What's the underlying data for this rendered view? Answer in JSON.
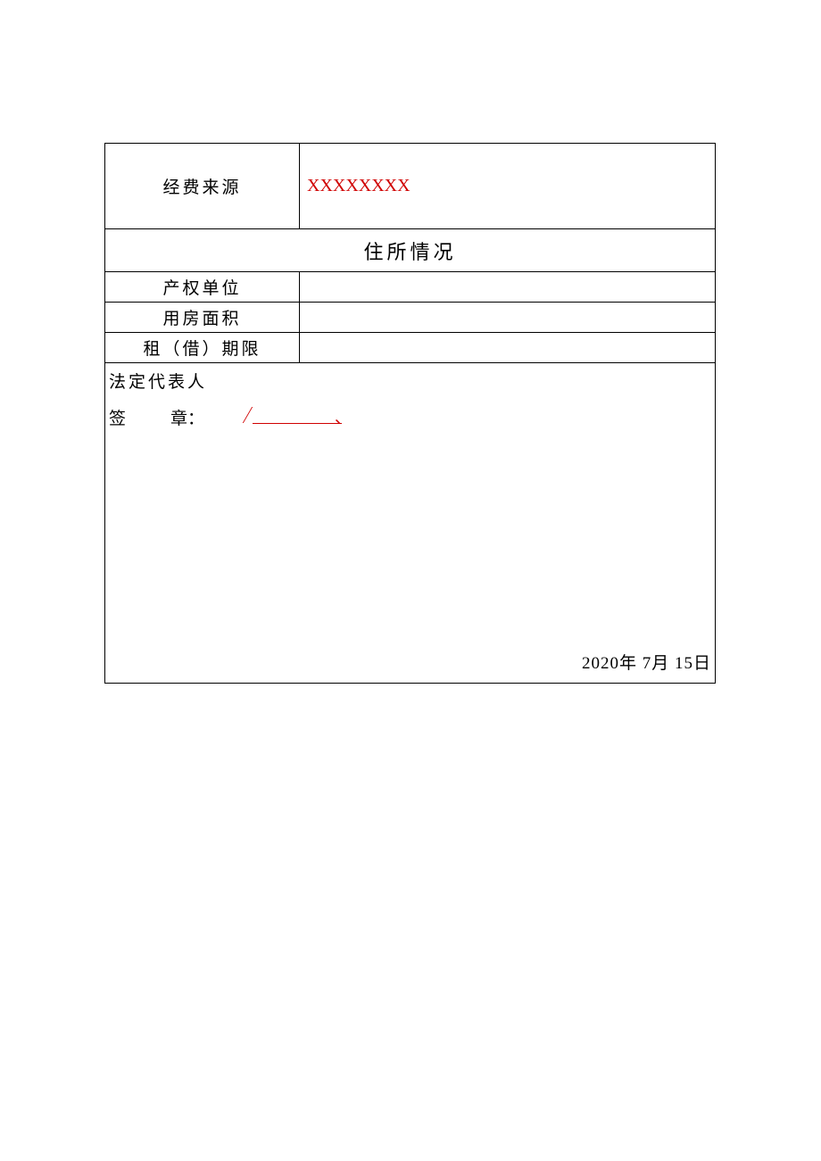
{
  "rows": {
    "fundingSource": {
      "label": "经费来源",
      "value": "XXXXXXXX"
    },
    "residenceHeader": "住所情况",
    "propertyUnit": {
      "label": "产权单位",
      "value": ""
    },
    "housingArea": {
      "label": "用房面积",
      "value": ""
    },
    "leasePeriod": {
      "label": "租（借）期限",
      "value": ""
    }
  },
  "signature": {
    "legalRep": "法定代表人",
    "sigLabel1": "签",
    "sigLabel2": "章："
  },
  "date": {
    "year": "2020",
    "yearUnit": "年",
    "month": "7",
    "monthUnit": "月",
    "day": "15",
    "dayUnit": "日"
  }
}
